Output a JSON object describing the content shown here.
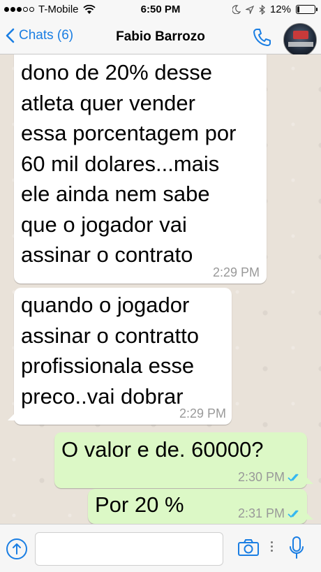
{
  "status_bar": {
    "carrier": "T-Mobile",
    "time": "6:50 PM",
    "battery_percent": "12%",
    "battery_level": 0.12,
    "signal_bars_filled": 3,
    "signal_bars_total": 5,
    "icons": [
      "wifi-icon",
      "moon-icon",
      "location-icon",
      "bluetooth-icon",
      "battery-icon"
    ]
  },
  "nav": {
    "back_label": "Chats (6)",
    "contact_name": "Fabio Barrozo",
    "accent_color": "#1a7ee3",
    "icons": [
      "chevron-left-icon",
      "phone-icon",
      "avatar"
    ]
  },
  "messages": [
    {
      "direction": "incoming",
      "text": "dono de 20% desse\natleta quer vender\nessa porcentagem por\n60 mil dolares...mais\nele ainda nem sabe\nque o jogador vai\nassinar o contrato",
      "time": "2:29 PM"
    },
    {
      "direction": "incoming",
      "text": "quando o jogador\nassinar o contratto\nprofissionala esse\npreco..vai dobrar",
      "time": "2:29 PM"
    },
    {
      "direction": "outgoing",
      "text": "O valor e de. 60000?",
      "time": "2:30 PM",
      "status": "read"
    },
    {
      "direction": "outgoing",
      "text": "Por 20 %",
      "time": "2:31 PM",
      "status": "read"
    }
  ],
  "input_bar": {
    "placeholder": "",
    "icons": [
      "upload-icon",
      "camera-icon",
      "microphone-icon"
    ]
  },
  "colors": {
    "incoming_bubble": "#ffffff",
    "outgoing_bubble": "#dcf8c6",
    "read_tick": "#34b7f1",
    "chat_background": "#e9e2d9"
  }
}
